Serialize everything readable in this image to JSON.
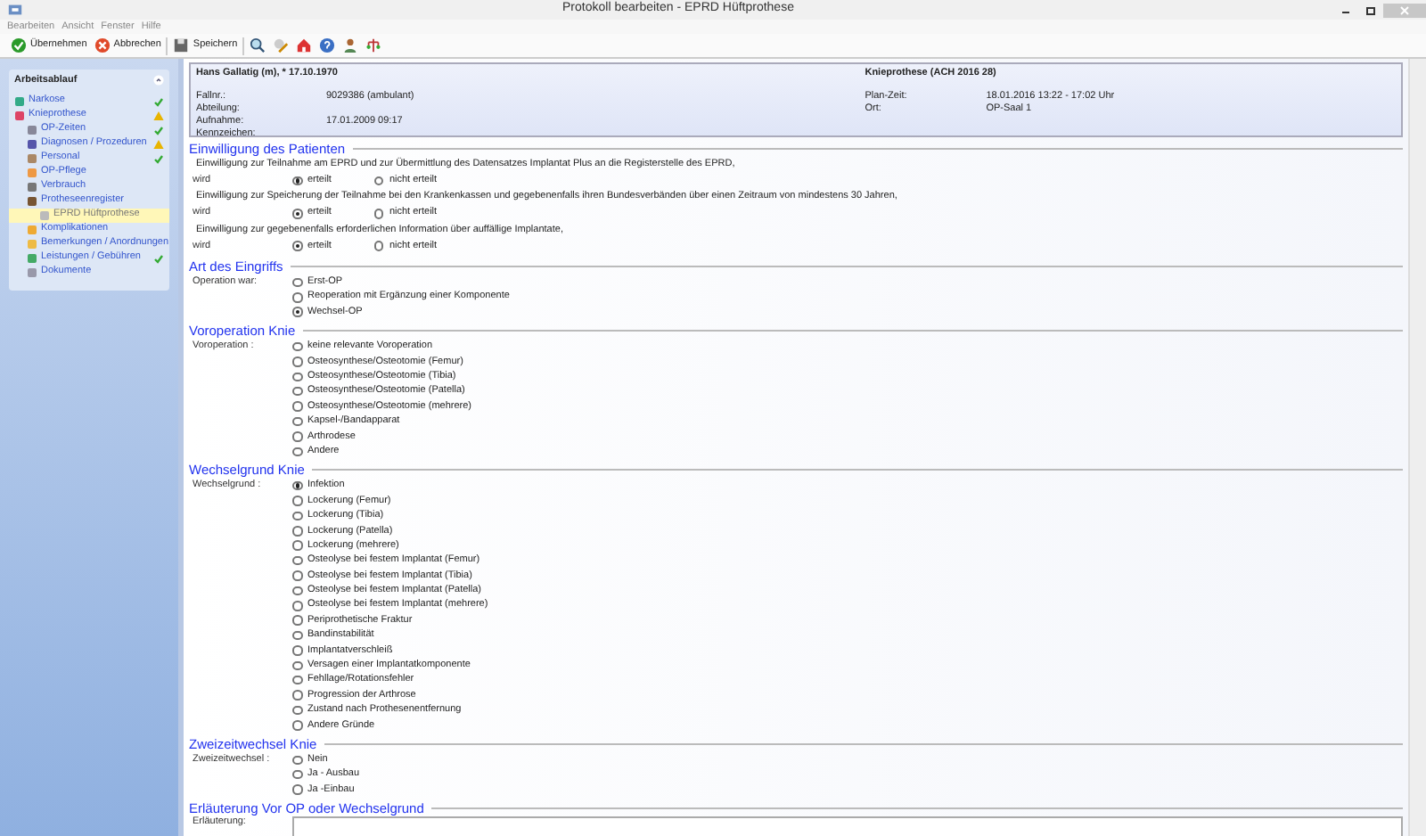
{
  "window": {
    "title": "Protokoll bearbeiten - EPRD Hüftprothese"
  },
  "menu": [
    "Bearbeiten",
    "Ansicht",
    "Fenster",
    "Hilfe"
  ],
  "toolbar": [
    {
      "kind": "ok",
      "label": "Übernehmen"
    },
    {
      "kind": "cancel",
      "label": "Abbrechen"
    },
    {
      "kind": "save",
      "label": "Speichern"
    },
    {
      "kind": "search"
    },
    {
      "kind": "edit"
    },
    {
      "kind": "home"
    },
    {
      "kind": "help"
    },
    {
      "kind": "person"
    },
    {
      "kind": "tree"
    }
  ],
  "sidebar": {
    "title": "Arbeitsablauf",
    "items": [
      {
        "label": "Narkose",
        "done": true,
        "warning": false,
        "selected": false
      },
      {
        "label": "Knieprothese",
        "done": false,
        "warning": true,
        "selected": false,
        "children": [
          {
            "label": "OP-Zeiten",
            "done": true,
            "warning": false,
            "selected": false
          },
          {
            "label": "Diagnosen / Prozeduren",
            "done": false,
            "warning": true,
            "selected": false
          },
          {
            "label": "Personal",
            "done": true,
            "warning": false,
            "selected": false
          },
          {
            "label": "OP-Pflege",
            "done": false,
            "warning": false,
            "selected": false
          },
          {
            "label": "Verbrauch",
            "done": false,
            "warning": false,
            "selected": false
          },
          {
            "label": "Protheseenregister",
            "done": false,
            "warning": false,
            "selected": false,
            "children": [
              {
                "label": "EPRD Hüftprothese",
                "done": false,
                "warning": false,
                "selected": true
              }
            ]
          },
          {
            "label": "Komplikationen",
            "done": false,
            "warning": false,
            "selected": false
          },
          {
            "label": "Bemerkungen / Anordnungen",
            "done": false,
            "warning": false,
            "selected": false
          },
          {
            "label": "Leistungen / Gebühren",
            "done": true,
            "warning": false,
            "selected": false
          },
          {
            "label": "Dokumente",
            "done": false,
            "warning": false,
            "selected": false
          }
        ]
      }
    ]
  },
  "header": {
    "patient": "Hans Gallatig (m), * 17.10.1970",
    "procedure": "Knieprothese (ACH 2016 28)",
    "left_fields": [
      {
        "label": "Fallnr.:",
        "value": "9029386 (ambulant)"
      },
      {
        "label": "Abteilung:"
      },
      {
        "label": "Aufnahme:",
        "value": "17.01.2009 09:17"
      },
      {
        "label": "Kennzeichen:"
      }
    ],
    "right_fields": [
      {
        "label": "Plan-Zeit:",
        "value": "18.01.2016 13:22 - 17:02 Uhr"
      },
      {
        "label": "Ort:",
        "value": "OP-Saal 1"
      }
    ]
  },
  "sections": [
    {
      "title": "Einwilligung des Patienten",
      "kind": "consent",
      "questions": [
        {
          "text": "Einwilligung zur Teilnahme am EPRD und zur Übermittlung des Datensatzes Implantat Plus an die Registerstelle des EPRD,",
          "label": "wird",
          "options": [
            {
              "label": "erteilt",
              "selected": true
            },
            {
              "label": "nicht erteilt",
              "selected": false
            }
          ]
        },
        {
          "text": "Einwilligung zur Speicherung der Teilnahme bei den Krankenkassen und gegebenenfalls ihren Bundesverbänden über einen Zeitraum von mindestens 30 Jahren,",
          "label": "wird",
          "options": [
            {
              "label": "erteilt",
              "selected": true
            },
            {
              "label": "nicht erteilt",
              "selected": false
            }
          ]
        },
        {
          "text": "Einwilligung zur gegebenenfalls erforderlichen Information über auffällige Implantate,",
          "label": "wird",
          "options": [
            {
              "label": "erteilt",
              "selected": true
            },
            {
              "label": "nicht erteilt",
              "selected": false
            }
          ]
        }
      ]
    },
    {
      "title": "Art des Eingriffs",
      "kind": "radio_group",
      "label": "Operation war:",
      "options": [
        {
          "label": "Erst-OP",
          "selected": false
        },
        {
          "label": "Reoperation mit Ergänzung einer Komponente",
          "selected": false
        },
        {
          "label": "Wechsel-OP",
          "selected": true
        }
      ]
    },
    {
      "title": "Voroperation Knie",
      "kind": "radio_group",
      "label": "Voroperation :",
      "options": [
        {
          "label": "keine relevante Voroperation",
          "selected": false
        },
        {
          "label": "Osteosynthese/Osteotomie (Femur)",
          "selected": false
        },
        {
          "label": "Osteosynthese/Osteotomie (Tibia)",
          "selected": false
        },
        {
          "label": "Osteosynthese/Osteotomie (Patella)",
          "selected": false
        },
        {
          "label": "Osteosynthese/Osteotomie (mehrere)",
          "selected": false
        },
        {
          "label": "Kapsel-/Bandapparat",
          "selected": false
        },
        {
          "label": "Arthrodese",
          "selected": false
        },
        {
          "label": "Andere",
          "selected": false
        }
      ]
    },
    {
      "title": "Wechselgrund Knie",
      "kind": "radio_group",
      "label": "Wechselgrund :",
      "options": [
        {
          "label": "Infektion",
          "selected": true
        },
        {
          "label": "Lockerung (Femur)",
          "selected": false
        },
        {
          "label": "Lockerung (Tibia)",
          "selected": false
        },
        {
          "label": "Lockerung (Patella)",
          "selected": false
        },
        {
          "label": "Lockerung (mehrere)",
          "selected": false
        },
        {
          "label": "Osteolyse bei festem Implantat (Femur)",
          "selected": false
        },
        {
          "label": "Osteolyse bei festem Implantat (Tibia)",
          "selected": false
        },
        {
          "label": "Osteolyse bei festem Implantat (Patella)",
          "selected": false
        },
        {
          "label": "Osteolyse bei festem Implantat (mehrere)",
          "selected": false
        },
        {
          "label": "Periprothetische Fraktur",
          "selected": false
        },
        {
          "label": "Bandinstabilität",
          "selected": false
        },
        {
          "label": "Implantatverschleiß",
          "selected": false
        },
        {
          "label": "Versagen einer Implantatkomponente",
          "selected": false
        },
        {
          "label": "Fehllage/Rotationsfehler",
          "selected": false
        },
        {
          "label": "Progression der Arthrose",
          "selected": false
        },
        {
          "label": "Zustand nach Prothesenentfernung",
          "selected": false
        },
        {
          "label": "Andere Gründe",
          "selected": false
        }
      ]
    },
    {
      "title": "Zweizeitwechsel Knie",
      "kind": "radio_group",
      "label": "Zweizeitwechsel :",
      "options": [
        {
          "label": "Nein",
          "selected": false
        },
        {
          "label": "Ja - Ausbau",
          "selected": false
        },
        {
          "label": "Ja -Einbau",
          "selected": false
        }
      ]
    },
    {
      "title": "Erläuterung Vor OP oder Wechselgrund",
      "kind": "textarea",
      "label": "Erläuterung:"
    }
  ]
}
